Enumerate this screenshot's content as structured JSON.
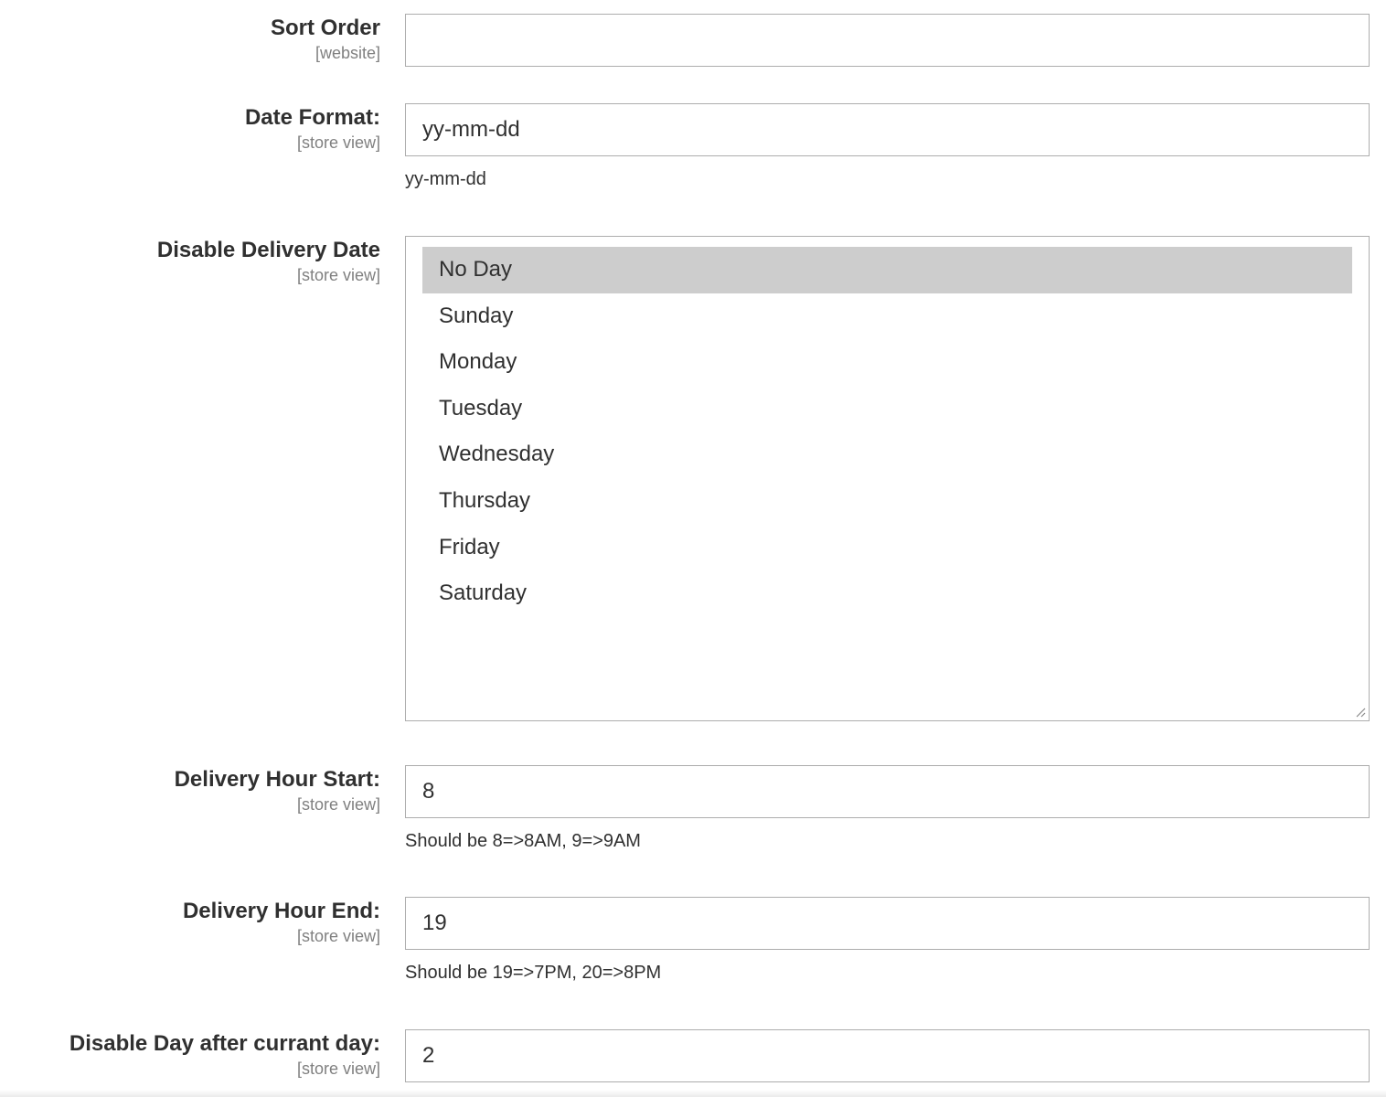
{
  "fields": {
    "sort_order": {
      "label": "Sort Order",
      "scope": "[website]",
      "value": ""
    },
    "date_format": {
      "label": "Date Format:",
      "scope": "[store view]",
      "value": "yy-mm-dd",
      "note": "yy-mm-dd"
    },
    "disable_delivery_date": {
      "label": "Disable Delivery Date",
      "scope": "[store view]",
      "options": [
        "No Day",
        "Sunday",
        "Monday",
        "Tuesday",
        "Wednesday",
        "Thursday",
        "Friday",
        "Saturday"
      ],
      "selected": "No Day"
    },
    "delivery_hour_start": {
      "label": "Delivery Hour Start:",
      "scope": "[store view]",
      "value": "8",
      "note": "Should be 8=>8AM, 9=>9AM"
    },
    "delivery_hour_end": {
      "label": "Delivery Hour End:",
      "scope": "[store view]",
      "value": "19",
      "note": "Should be 19=>7PM, 20=>8PM"
    },
    "disable_day_after": {
      "label": "Disable Day after currant day:",
      "scope": "[store view]",
      "value": "2"
    }
  },
  "colors": {
    "input_border": "#adadad",
    "selected_option_bg": "#cdcdcd",
    "scope_text": "#808080",
    "label_text": "#303030"
  }
}
